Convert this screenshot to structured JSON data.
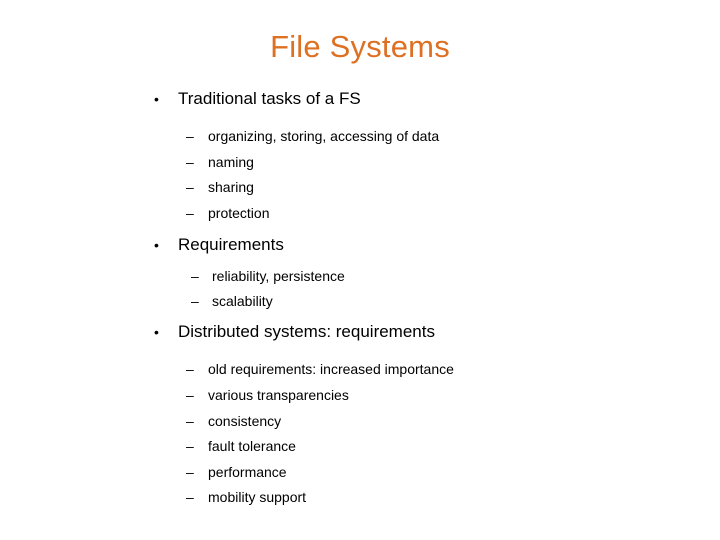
{
  "slide": {
    "title": "File Systems",
    "title_color": "#dd7023",
    "body_color": "#000000",
    "background_color": "#ffffff",
    "bullet_marker": "•",
    "dash_marker": "–",
    "sections": [
      {
        "heading": "Traditional tasks of a FS",
        "items": [
          "organizing, storing, accessing of data",
          "naming",
          "sharing",
          "protection"
        ]
      },
      {
        "heading": "Requirements",
        "items": [
          "reliability, persistence",
          "scalability"
        ]
      },
      {
        "heading": "Distributed systems: requirements",
        "items": [
          "old requirements: increased importance",
          "various transparencies",
          "consistency",
          "fault tolerance",
          "performance",
          "mobility support"
        ]
      }
    ]
  }
}
